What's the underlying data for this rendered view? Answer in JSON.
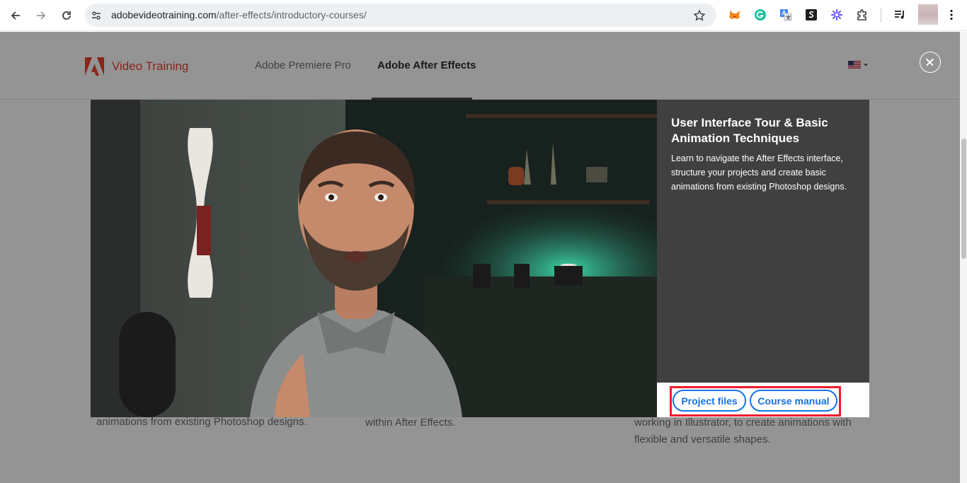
{
  "browser": {
    "url_host": "adobevideotraining.com",
    "url_path": "/after-effects/introductory-courses/",
    "icons": [
      "back-arrow-icon",
      "forward-arrow-icon",
      "reload-icon",
      "site-settings-icon",
      "bookmark-star-icon",
      "metamask-fox-icon",
      "grammarly-icon",
      "google-translate-icon",
      "s-extension-icon",
      "sparkle-extension-icon",
      "puzzle-extensions-icon",
      "media-queue-icon",
      "profile-avatar",
      "kebab-menu-icon"
    ]
  },
  "site": {
    "logo_text": "Video Training",
    "nav": [
      "Adobe Premiere Pro",
      "Adobe After Effects"
    ],
    "active_nav": "Adobe After Effects",
    "brand_color": "#e8432d"
  },
  "background_text": {
    "col1": "animations from existing Photoshop designs.",
    "col2": "within After Effects.",
    "col3_line1": "working in Illustrator, to create animations with",
    "col3_line2": "flexible and versatile shapes."
  },
  "modal": {
    "title": "User Interface Tour & Basic Animation Techniques",
    "description": "Learn to navigate the After Effects interface, structure your projects and create basic animations from existing Photoshop designs.",
    "buttons": {
      "project_files": "Project files",
      "course_manual": "Course manual"
    },
    "accent_color": "#1473e6",
    "highlight_color": "#ee1c2e"
  }
}
